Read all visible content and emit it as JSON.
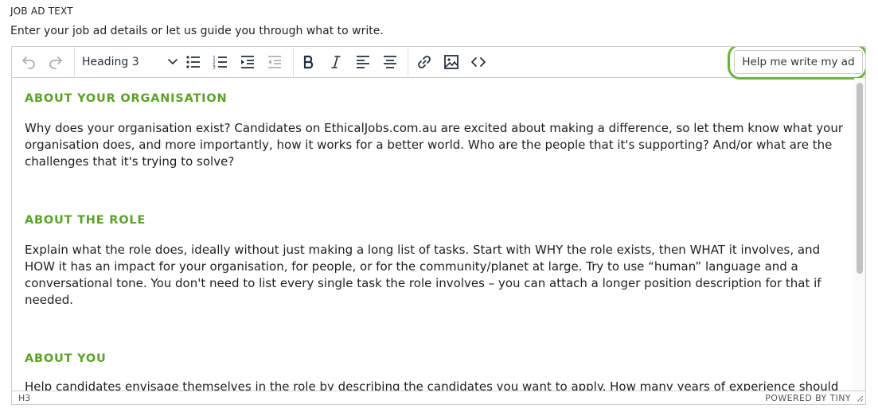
{
  "field": {
    "label": "JOB AD TEXT",
    "hint": "Enter your job ad details or let us guide you through what to write."
  },
  "toolbar": {
    "block_format": "Heading 3",
    "help_button": "Help me write my ad",
    "icons": [
      "undo-icon",
      "redo-icon",
      "chevron-down-icon",
      "bullet-list-icon",
      "numbered-list-icon",
      "indent-icon",
      "outdent-icon",
      "bold-icon",
      "italic-icon",
      "align-left-icon",
      "align-center-icon",
      "link-icon",
      "image-icon",
      "code-icon"
    ]
  },
  "content": {
    "sections": [
      {
        "heading": "ABOUT YOUR ORGANISATION",
        "body": "Why does your organisation exist? Candidates on EthicalJobs.com.au are excited about making a difference, so let them know what your organisation does, and more importantly, how it works for a better world. Who are the people that it's supporting? And/or what are the challenges that it's trying to solve?"
      },
      {
        "heading": "ABOUT THE ROLE",
        "body": "Explain what the role does, ideally without just making a long list of tasks. Start with WHY the role exists, then WHAT it involves, and HOW it has an impact for your organisation, for people, or for the community/planet at large. Try to use “human” language and a conversational tone. You don't need to list every single task the role involves – you can attach a longer position description for that if needed."
      },
      {
        "heading": "ABOUT YOU",
        "body": "Help candidates envisage themselves in the role by describing the candidates you want to apply. How many years of experience should"
      }
    ]
  },
  "statusbar": {
    "path": "H3",
    "brand": "POWERED BY TINY"
  },
  "colors": {
    "heading_green": "#5aa226",
    "highlight_ring": "#6ab33b",
    "border": "#cccccc"
  }
}
